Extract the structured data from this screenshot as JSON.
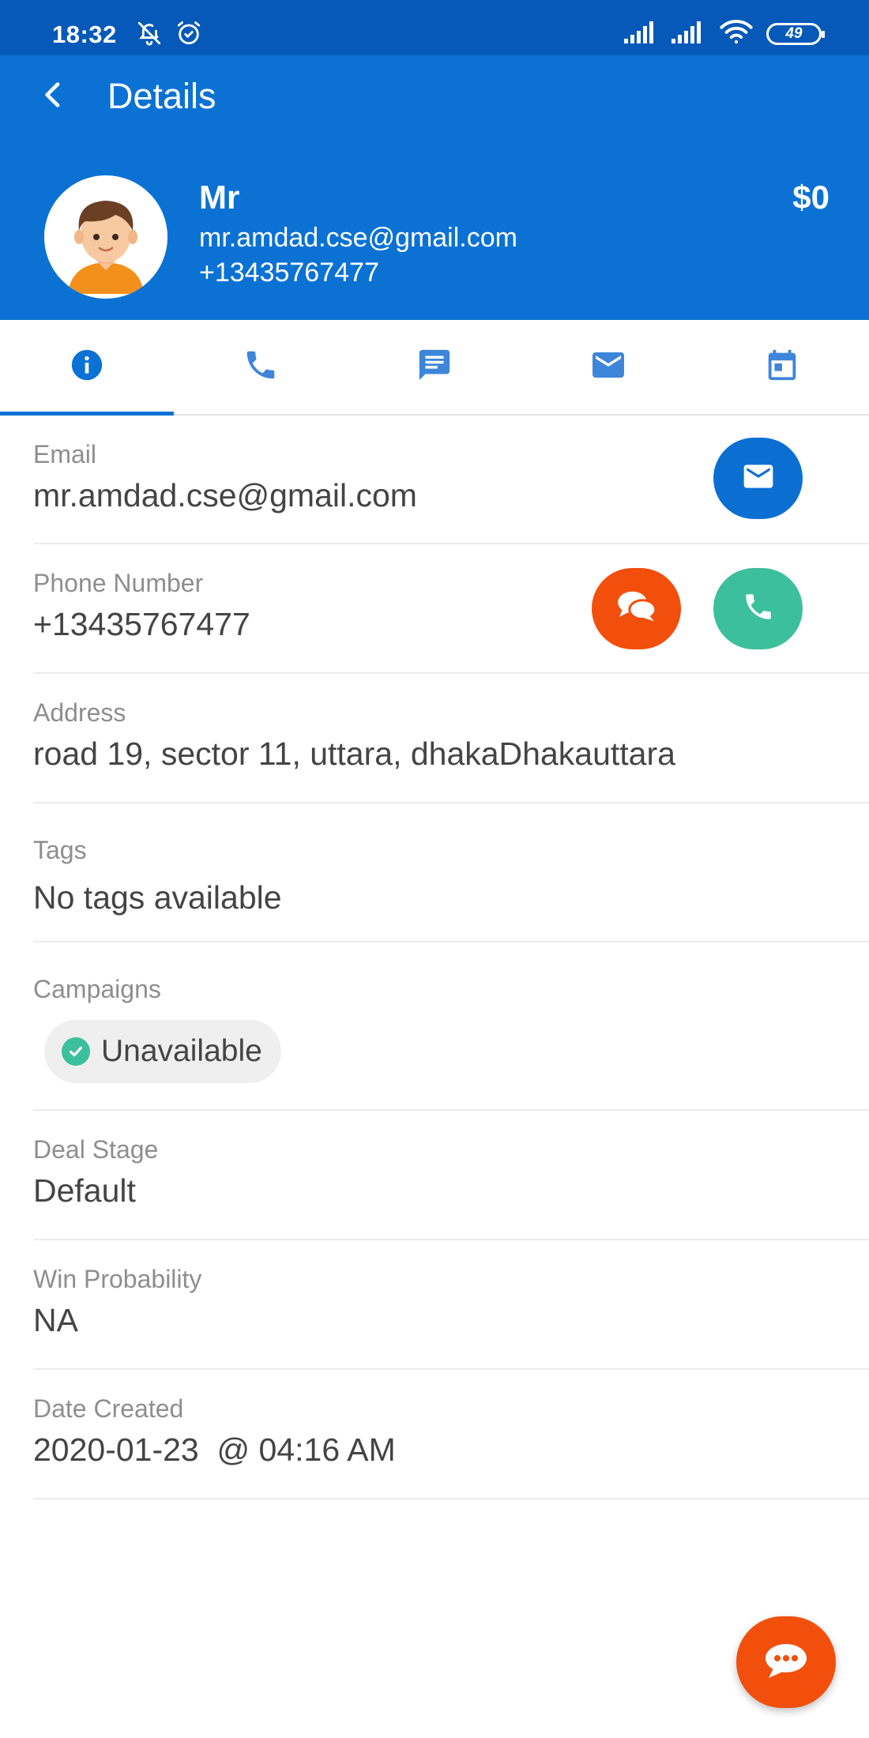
{
  "status_bar": {
    "time": "18:32",
    "battery": "49"
  },
  "header": {
    "title": "Details",
    "back_icon": "chevron-left-icon"
  },
  "contact": {
    "name": "Mr",
    "email": "mr.amdad.cse@gmail.com",
    "phone": "+13435767477",
    "value": "$0"
  },
  "tabs": [
    {
      "icon": "info-icon",
      "active": true
    },
    {
      "icon": "phone-icon",
      "active": false
    },
    {
      "icon": "message-icon",
      "active": false
    },
    {
      "icon": "mail-icon",
      "active": false
    },
    {
      "icon": "calendar-icon",
      "active": false
    }
  ],
  "fields": {
    "email": {
      "label": "Email",
      "value": "mr.amdad.cse@gmail.com"
    },
    "phone": {
      "label": "Phone Number",
      "value": "+13435767477"
    },
    "address": {
      "label": "Address",
      "value": "road 19, sector 11, uttara, dhakaDhakauttara"
    },
    "tags": {
      "label": "Tags",
      "value": "No tags available"
    },
    "campaigns": {
      "label": "Campaigns",
      "chip": "Unavailable"
    },
    "deal_stage": {
      "label": "Deal Stage",
      "value": "Default"
    },
    "win_probability": {
      "label": "Win Probability",
      "value": "NA"
    },
    "date_created": {
      "label": "Date Created",
      "value": "2020-01-23  @ 04:16 AM"
    }
  },
  "colors": {
    "primary": "#0b72d4",
    "status_bar": "#0659b8",
    "accent_orange": "#f24f0c",
    "accent_green": "#3cbf9c"
  }
}
